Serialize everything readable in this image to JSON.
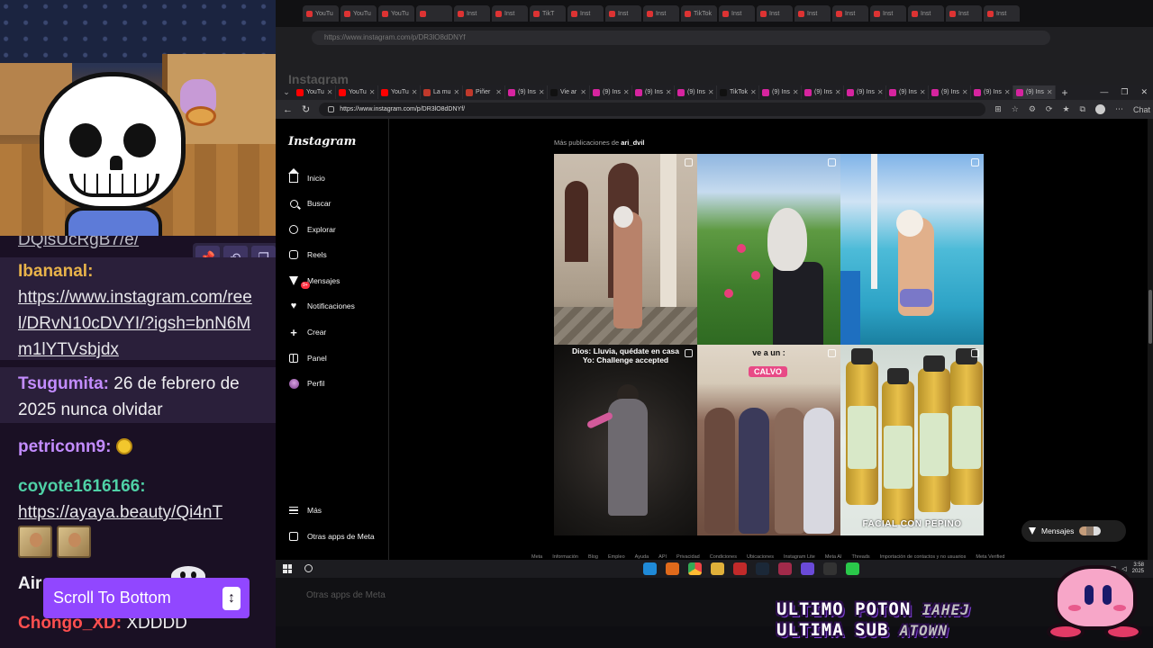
{
  "chat": {
    "messages": [
      {
        "user": "",
        "text": "DQlsUcRgB7/e/",
        "link": true,
        "color": "#bcbcc6"
      },
      {
        "user": "Ibananal:",
        "text": "https://www.instagram.com/reel/DRvN10cDVYI/?igsh=bnN6Mm1lYTVsbjdx",
        "link": true,
        "color": "#e8b34a"
      },
      {
        "user": "Tsugumita:",
        "text": " 26 de febrero de 2025 nunca olvidar",
        "link": false,
        "color": "#c38cff"
      },
      {
        "user": "petriconn9:",
        "text": "",
        "link": false,
        "color": "#c38cff"
      },
      {
        "user": "coyote1616166:",
        "text": "https://ayaya.beauty/Qi4nT",
        "link": true,
        "color": "#4fd1a6"
      },
      {
        "user": "Air",
        "text": "",
        "link": false,
        "color": "#efeff1"
      },
      {
        "user": "Chongo_XD:",
        "text": " XDDDD",
        "link": false,
        "color": "#ff4f4f"
      }
    ],
    "scroll_bottom_label": "Scroll To Bottom"
  },
  "back_browser": {
    "url": "https://www.instagram.com/p/DR3lO8dDNYf",
    "title": "Instagram",
    "tab_labels": [
      "YouTu",
      "YouTu",
      "YouTu",
      "",
      "Inst",
      "Inst",
      "TikT",
      "Inst",
      "Inst",
      "Inst",
      "TikTok",
      "Inst",
      "Inst",
      "Inst",
      "Inst",
      "Inst",
      "Inst",
      "Inst",
      "Inst"
    ],
    "otras_apps": "Otras apps de Meta"
  },
  "browser": {
    "tabs": [
      {
        "label": "YouTu",
        "color": "#ff0000"
      },
      {
        "label": "YouTu",
        "color": "#ff0000"
      },
      {
        "label": "YouTu",
        "color": "#ff0000"
      },
      {
        "label": "La mu",
        "color": "#c0392b"
      },
      {
        "label": "Piñer",
        "color": "#c0392b"
      },
      {
        "label": "(9) Ins",
        "color": "#d6249f"
      },
      {
        "label": "Vie ar",
        "color": "#111111"
      },
      {
        "label": "(9) Ins",
        "color": "#d6249f"
      },
      {
        "label": "(9) Ins",
        "color": "#d6249f"
      },
      {
        "label": "(9) Ins",
        "color": "#d6249f"
      },
      {
        "label": "TikTok",
        "color": "#111111"
      },
      {
        "label": "(9) Ins",
        "color": "#d6249f"
      },
      {
        "label": "(9) Ins",
        "color": "#d6249f"
      },
      {
        "label": "(9) Ins",
        "color": "#d6249f"
      },
      {
        "label": "(9) Ins",
        "color": "#d6249f"
      },
      {
        "label": "(9) Ins",
        "color": "#d6249f"
      },
      {
        "label": "(9) Ins",
        "color": "#d6249f"
      },
      {
        "label": "(9) Ins",
        "color": "#d6249f"
      }
    ],
    "url": "https://www.instagram.com/p/DR3lO8dDNYf/",
    "chat_label": "Chat"
  },
  "instagram": {
    "logo": "Instagram",
    "nav": [
      {
        "label": "Inicio",
        "icon": "home-icon"
      },
      {
        "label": "Buscar",
        "icon": "search-icon"
      },
      {
        "label": "Explorar",
        "icon": "explore-icon"
      },
      {
        "label": "Reels",
        "icon": "reels-icon"
      },
      {
        "label": "Mensajes",
        "icon": "messages-icon",
        "badge": "9+"
      },
      {
        "label": "Notificaciones",
        "icon": "heart-icon"
      },
      {
        "label": "Crear",
        "icon": "plus-icon"
      },
      {
        "label": "Panel",
        "icon": "panel-icon"
      },
      {
        "label": "Perfil",
        "icon": "profile-icon"
      }
    ],
    "more_label": "Más",
    "meta_label": "Otras apps de Meta",
    "more_posts_prefix": "Más publicaciones de ",
    "more_posts_user": "ari_dvil",
    "posts": [
      {
        "caption": ""
      },
      {
        "caption": ""
      },
      {
        "caption": ""
      },
      {
        "caption": "Dios: Lluvia, quédate en casa\nYo: Challenge accepted"
      },
      {
        "caption": "ve a un :",
        "tag": "CALVO"
      },
      {
        "caption": "FACIAL CON PEPINO"
      }
    ],
    "footer": [
      "Meta",
      "Información",
      "Blog",
      "Empleo",
      "Ayuda",
      "API",
      "Privacidad",
      "Condiciones",
      "Ubicaciones",
      "Instagram Lite",
      "Meta AI",
      "Threads",
      "Importación de contactos y no usuarios",
      "Meta Verified"
    ],
    "messages_bubble": "Mensajes",
    "messages_badge": "9+"
  },
  "taskbar": {
    "time": "3:58",
    "date": "2025"
  },
  "overlay": {
    "line1": "ULTIMO POTON",
    "line1_suffix": "IAHEJ",
    "line2": "ULTIMA SUB",
    "line2_suffix": "ATOWN"
  }
}
